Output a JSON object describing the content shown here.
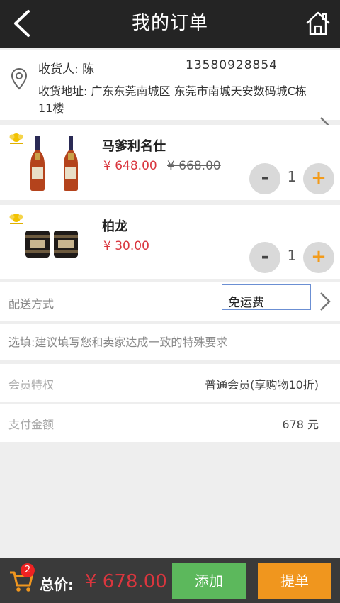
{
  "header": {
    "title": "我的订单",
    "back_icon": "back-arrow-icon",
    "home_icon": "home-icon"
  },
  "address": {
    "receiver_line": "收货人: 陈",
    "phone": "13580928854",
    "address_line": "收货地址: 广东东莞南城区 东莞市南城天安数码城C栋11楼"
  },
  "products": [
    {
      "name": "马爹利名仕",
      "price": "¥ 648.00",
      "old_price": "¥ 668.00",
      "qty": "1"
    },
    {
      "name": "柏龙",
      "price": "¥ 30.00",
      "old_price": "",
      "qty": "1"
    }
  ],
  "controls": {
    "minus": "-",
    "plus": "+"
  },
  "shipping": {
    "label": "配送方式",
    "value": "免运费"
  },
  "note": {
    "placeholder": "选填:建议填写您和卖家达成一致的特殊要求"
  },
  "member": {
    "label": "会员特权",
    "value": "普通会员(享购物10折)"
  },
  "payment": {
    "label": "支付金额",
    "value": "678 元"
  },
  "bottom_bar": {
    "cart_badge": "2",
    "total_label": "总价:",
    "total_value": "¥ 678.00",
    "add_button": "添加",
    "submit_button": "提单"
  },
  "colors": {
    "header_bg": "#242424",
    "price_red": "#d9363e",
    "accent_orange": "#f0961e",
    "green": "#5cb85c"
  }
}
